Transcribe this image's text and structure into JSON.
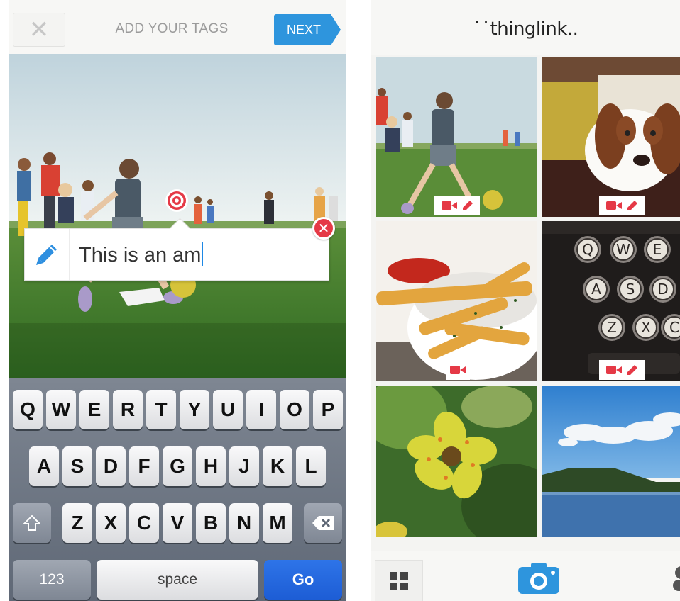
{
  "editor": {
    "title": "ADD YOUR TAGS",
    "next_label": "NEXT",
    "close_symbol": "✕",
    "tag_text": "This is an am",
    "remove_symbol": "✕"
  },
  "keyboard": {
    "row1": [
      "Q",
      "W",
      "E",
      "R",
      "T",
      "Y",
      "U",
      "I",
      "O",
      "P"
    ],
    "row2": [
      "A",
      "S",
      "D",
      "F",
      "G",
      "H",
      "J",
      "K",
      "L"
    ],
    "row3": [
      "Z",
      "X",
      "C",
      "V",
      "B",
      "N",
      "M"
    ],
    "numbers_label": "123",
    "space_label": "space",
    "go_label": "Go"
  },
  "feed": {
    "logo": "˙˙thinglink..",
    "tiles": [
      {
        "name": "kids-playing-ball",
        "badges": [
          "video-icon",
          "pencil-icon"
        ]
      },
      {
        "name": "dog-on-sofa",
        "badges": [
          "video-icon",
          "pencil-icon"
        ]
      },
      {
        "name": "french-fries-bowl",
        "badges": [
          "video-icon"
        ]
      },
      {
        "name": "typewriter-keys",
        "badges": [
          "video-icon",
          "pencil-icon"
        ]
      },
      {
        "name": "yellow-flower",
        "badges": []
      },
      {
        "name": "lake-and-sky",
        "badges": []
      }
    ],
    "typewriter_keys": [
      "Q",
      "W",
      "E",
      "A",
      "S",
      "D",
      "Z",
      "X",
      "C"
    ]
  },
  "colors": {
    "accent_blue": "#2e95dd",
    "badge_red": "#e53946",
    "go_blue": "#1d5dd5"
  }
}
